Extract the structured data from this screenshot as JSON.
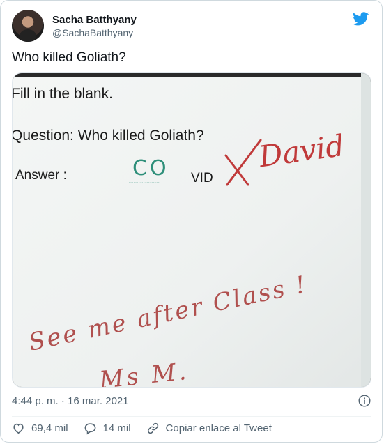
{
  "tweet": {
    "author": {
      "display_name": "Sacha Batthyany",
      "handle": "@SachaBatthyany"
    },
    "text": "Who killed Goliath?",
    "timestamp": "4:44 p. m. · 16 mar. 2021",
    "actions": {
      "likes": "69,4 mil",
      "replies": "14 mil",
      "copy_link": "Copiar enlace al Tweet"
    },
    "photo": {
      "line1": "Fill in the blank.",
      "question": "Question: Who killed Goliath?",
      "answer_label": "Answer :",
      "answer_dots": "...................",
      "handwritten_co": "CO",
      "printed_vid": "VID",
      "handwritten_correction": "David",
      "handwritten_note": "See me after Class !",
      "handwritten_signature": "Ms M."
    }
  },
  "colors": {
    "twitter_blue": "#1d9bf0",
    "secondary_text": "#536471",
    "ink_green": "#2e8f7a",
    "ink_red": "#c03a3a"
  },
  "icons": {
    "brand": "twitter-bird-icon",
    "info": "info-icon",
    "like": "heart-icon",
    "reply": "reply-bubble-icon",
    "link": "link-icon"
  }
}
